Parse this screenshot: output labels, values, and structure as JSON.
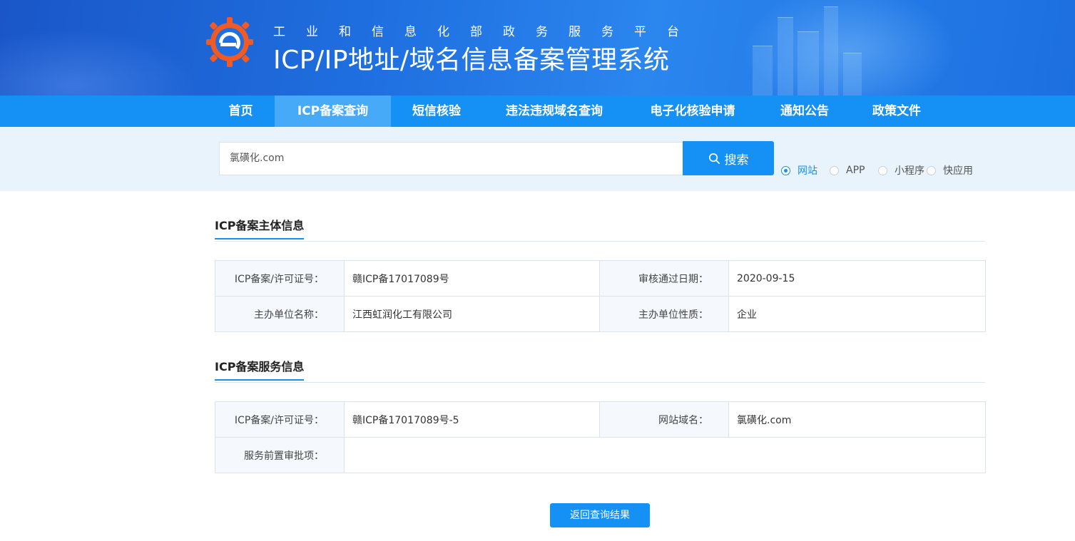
{
  "header": {
    "subtitle": "工业和信息化部政务服务平台",
    "title": "ICP/IP地址/域名信息备案管理系统",
    "logo_icon": "gear-e-logo-icon"
  },
  "nav": {
    "items": [
      {
        "label": "首页",
        "active": false
      },
      {
        "label": "ICP备案查询",
        "active": true
      },
      {
        "label": "短信核验",
        "active": false
      },
      {
        "label": "违法违规域名查询",
        "active": false
      },
      {
        "label": "电子化核验申请",
        "active": false
      },
      {
        "label": "通知公告",
        "active": false
      },
      {
        "label": "政策文件",
        "active": false
      }
    ]
  },
  "search": {
    "value": "氯磺化.com",
    "button_label": "搜索",
    "button_icon": "search-icon",
    "types": [
      {
        "label": "网站",
        "checked": true
      },
      {
        "label": "APP",
        "checked": false
      },
      {
        "label": "小程序",
        "checked": false
      },
      {
        "label": "快应用",
        "checked": false
      }
    ]
  },
  "subject_info": {
    "title": "ICP备案主体信息",
    "rows": [
      [
        {
          "key": "ICP备案/许可证号：",
          "value": "赣ICP备17017089号"
        },
        {
          "key": "审核通过日期：",
          "value": "2020-09-15"
        }
      ],
      [
        {
          "key": "主办单位名称：",
          "value": "江西虹润化工有限公司"
        },
        {
          "key": "主办单位性质：",
          "value": "企业"
        }
      ]
    ]
  },
  "service_info": {
    "title": "ICP备案服务信息",
    "rows": [
      [
        {
          "key": "ICP备案/许可证号：",
          "value": "赣ICP备17017089号-5"
        },
        {
          "key": "网站域名：",
          "value": "氯磺化.com"
        }
      ],
      [
        {
          "key": "服务前置审批项：",
          "value": ""
        }
      ]
    ]
  },
  "back_button": "返回查询结果",
  "colors": {
    "primary": "#1590f5",
    "nav_active": "#47aaf9",
    "search_bg": "#e8f3fc",
    "key_cell_bg": "#f5f9fd"
  }
}
